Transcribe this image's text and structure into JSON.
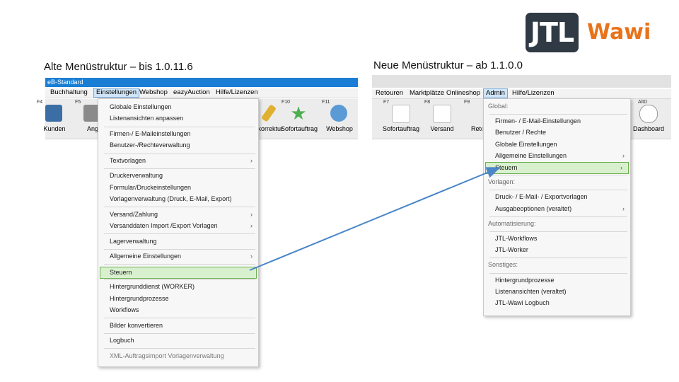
{
  "logo": {
    "mark": "JTL",
    "product": "Wawi"
  },
  "headings": {
    "old": "Alte Menüstruktur – bis 1.0.11.6",
    "new": "Neue Menüstruktur – ab 1.1.0.0"
  },
  "old_ui": {
    "title": "eB-Standard",
    "menu": [
      "Buchhaltung",
      "Einstellungen",
      "Webshop",
      "eazyAuction",
      "Hilfe/Lizenzen"
    ],
    "toolbar": [
      {
        "key": "F4",
        "label": "Kunden",
        "icon": "customers-icon",
        "color": "#3b6ea5"
      },
      {
        "key": "F5",
        "label": "Ang",
        "icon": "offer-icon",
        "color": "#8a8a8a"
      },
      {
        "key": "",
        "label": "rchkorrektur",
        "icon": "pencil-icon",
        "color": "#e0b030"
      },
      {
        "key": "F10",
        "label": "Sofortauftrag",
        "icon": "star-icon",
        "color": "#4caf50"
      },
      {
        "key": "F11",
        "label": "Webshop",
        "icon": "cloud-icon",
        "color": "#5b9bd5"
      }
    ],
    "dropdown": [
      {
        "label": "Globale Einstellungen",
        "sep_after": false
      },
      {
        "label": "Listenansichten anpassen",
        "sep_after": true
      },
      {
        "label": "Firmen-/ E-Maileinstellungen",
        "sep_after": false
      },
      {
        "label": "Benutzer-/Rechteverwaltung",
        "sep_after": true
      },
      {
        "label": "Textvorlagen",
        "submenu": true,
        "sep_after": true
      },
      {
        "label": "Druckerverwaltung",
        "sep_after": false
      },
      {
        "label": "Formular/Druckeinstellungen",
        "sep_after": false
      },
      {
        "label": "Vorlagenverwaltung (Druck, E-Mail, Export)",
        "sep_after": true
      },
      {
        "label": "Versand/Zahlung",
        "submenu": true,
        "sep_after": false
      },
      {
        "label": "Versanddaten Import /Export Vorlagen",
        "submenu": true,
        "sep_after": true
      },
      {
        "label": "Lagerverwaltung",
        "sep_after": true
      },
      {
        "label": "Allgemeine Einstellungen",
        "submenu": true,
        "sep_after": true
      },
      {
        "label": "Steuern",
        "highlight": true,
        "sep_after": true
      },
      {
        "label": "Hintergrunddienst (WORKER)",
        "sep_after": false
      },
      {
        "label": "Hintergrundprozesse",
        "sep_after": false
      },
      {
        "label": "Workflows",
        "sep_after": true
      },
      {
        "label": "Bilder konvertieren",
        "sep_after": true
      },
      {
        "label": "Logbuch",
        "sep_after": true
      },
      {
        "label": "XML-Auftragsimport Vorlagenverwaltung",
        "disabled": true,
        "sep_after": false
      }
    ]
  },
  "new_ui": {
    "menu": [
      "Retouren",
      "Marktplätze",
      "Onlineshop",
      "Admin",
      "Hilfe/Lizenzen"
    ],
    "toolbar": [
      {
        "key": "F7",
        "label": "Sofortauftrag",
        "icon": "order-icon",
        "color": "#e87a2a"
      },
      {
        "key": "F8",
        "label": "Versand",
        "icon": "shipping-icon",
        "color": "#e87a2a"
      },
      {
        "key": "F9",
        "label": "Reto",
        "icon": "return-icon",
        "color": "#999999"
      },
      {
        "key": "AltD",
        "label": "Dashboard",
        "icon": "dashboard-icon",
        "color": "#7a7a7a"
      }
    ],
    "dropdown": [
      {
        "label": "Global:",
        "header": true
      },
      {
        "label": "Firmen- / E-Mail-Einstellungen"
      },
      {
        "label": "Benutzer / Rechte"
      },
      {
        "label": "Globale Einstellungen"
      },
      {
        "label": "Allgemeine Einstellungen",
        "submenu": true
      },
      {
        "label": "Steuern",
        "submenu": true,
        "highlight": true
      },
      {
        "label": "Vorlagen:",
        "header": true
      },
      {
        "label": "Druck- / E-Mail- / Exportvorlagen"
      },
      {
        "label": "Ausgabeoptionen (veraltet)",
        "submenu": true
      },
      {
        "label": "Automatisierung:",
        "header": true
      },
      {
        "label": "JTL-Workflows"
      },
      {
        "label": "JTL-Worker"
      },
      {
        "label": "Sonstiges:",
        "header": true
      },
      {
        "label": "Hintergrundprozesse"
      },
      {
        "label": "Listenansichten (veraltet)"
      },
      {
        "label": "JTL-Wawi Logbuch"
      }
    ]
  },
  "colors": {
    "accent_blue": "#1a7fd4",
    "highlight_green": "#6ab04c",
    "arrow": "#4a86c8",
    "logo_orange": "#e8731b"
  }
}
